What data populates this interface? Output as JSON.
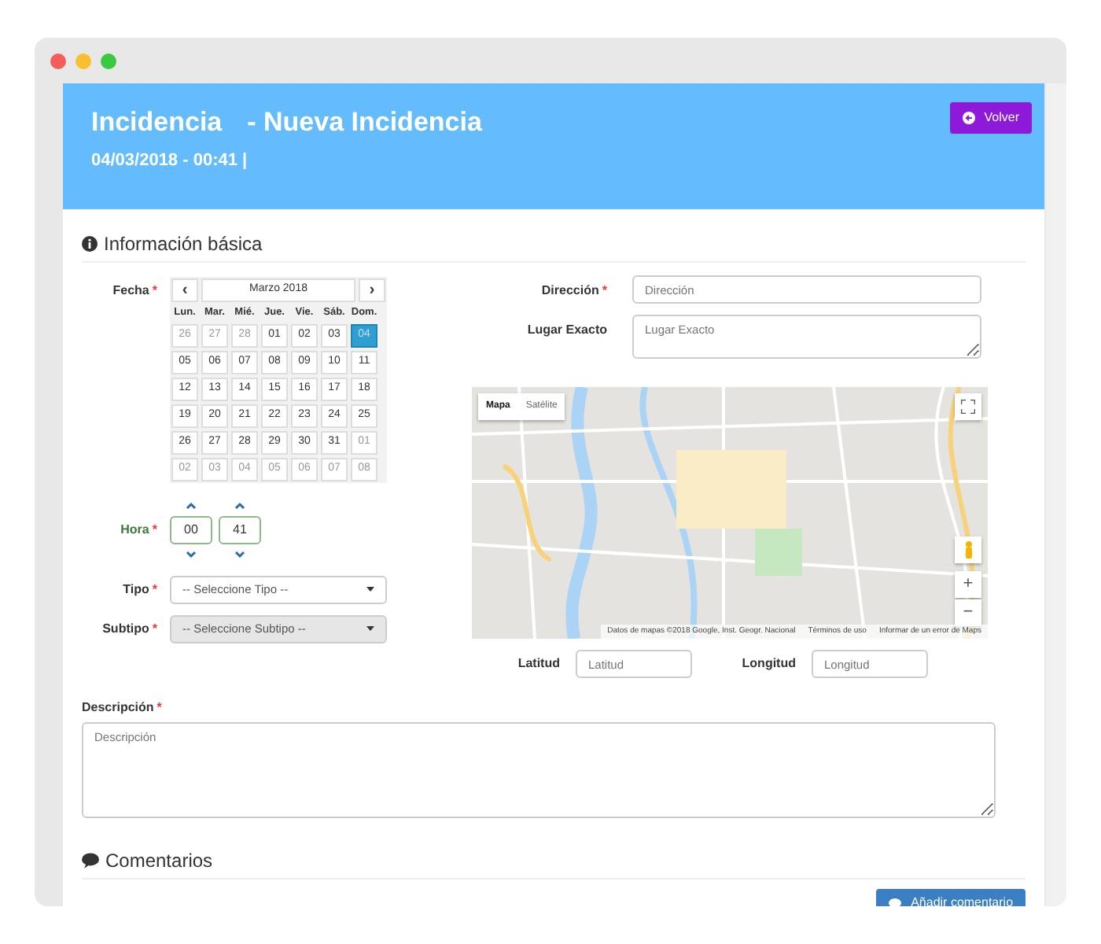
{
  "header": {
    "title": "Incidencia",
    "subtitle": "- Nueva Incidencia",
    "datetime": "04/03/2018 - 00:41 |",
    "back_button": "Volver"
  },
  "basic_section": {
    "title": "Información básica"
  },
  "fecha": {
    "label": "Fecha",
    "mark": "*",
    "calendar": {
      "prev": "‹",
      "next": "›",
      "month": "Marzo 2018",
      "weekdays": [
        "Lun.",
        "Mar.",
        "Mié.",
        "Jue.",
        "Vie.",
        "Sáb.",
        "Dom."
      ],
      "weeks": [
        [
          {
            "day": "26",
            "muted": true,
            "selected": false
          },
          {
            "day": "27",
            "muted": true,
            "selected": false
          },
          {
            "day": "28",
            "muted": true,
            "selected": false
          },
          {
            "day": "01",
            "muted": false,
            "selected": false
          },
          {
            "day": "02",
            "muted": false,
            "selected": false
          },
          {
            "day": "03",
            "muted": false,
            "selected": false
          },
          {
            "day": "04",
            "muted": false,
            "selected": true
          }
        ],
        [
          {
            "day": "05",
            "muted": false,
            "selected": false
          },
          {
            "day": "06",
            "muted": false,
            "selected": false
          },
          {
            "day": "07",
            "muted": false,
            "selected": false
          },
          {
            "day": "08",
            "muted": false,
            "selected": false
          },
          {
            "day": "09",
            "muted": false,
            "selected": false
          },
          {
            "day": "10",
            "muted": false,
            "selected": false
          },
          {
            "day": "11",
            "muted": false,
            "selected": false
          }
        ],
        [
          {
            "day": "12",
            "muted": false,
            "selected": false
          },
          {
            "day": "13",
            "muted": false,
            "selected": false
          },
          {
            "day": "14",
            "muted": false,
            "selected": false
          },
          {
            "day": "15",
            "muted": false,
            "selected": false
          },
          {
            "day": "16",
            "muted": false,
            "selected": false
          },
          {
            "day": "17",
            "muted": false,
            "selected": false
          },
          {
            "day": "18",
            "muted": false,
            "selected": false
          }
        ],
        [
          {
            "day": "19",
            "muted": false,
            "selected": false
          },
          {
            "day": "20",
            "muted": false,
            "selected": false
          },
          {
            "day": "21",
            "muted": false,
            "selected": false
          },
          {
            "day": "22",
            "muted": false,
            "selected": false
          },
          {
            "day": "23",
            "muted": false,
            "selected": false
          },
          {
            "day": "24",
            "muted": false,
            "selected": false
          },
          {
            "day": "25",
            "muted": false,
            "selected": false
          }
        ],
        [
          {
            "day": "26",
            "muted": false,
            "selected": false
          },
          {
            "day": "27",
            "muted": false,
            "selected": false
          },
          {
            "day": "28",
            "muted": false,
            "selected": false
          },
          {
            "day": "29",
            "muted": false,
            "selected": false
          },
          {
            "day": "30",
            "muted": false,
            "selected": false
          },
          {
            "day": "31",
            "muted": false,
            "selected": false
          },
          {
            "day": "01",
            "muted": true,
            "selected": false
          }
        ],
        [
          {
            "day": "02",
            "muted": true,
            "selected": false
          },
          {
            "day": "03",
            "muted": true,
            "selected": false
          },
          {
            "day": "04",
            "muted": true,
            "selected": false
          },
          {
            "day": "05",
            "muted": true,
            "selected": false
          },
          {
            "day": "06",
            "muted": true,
            "selected": false
          },
          {
            "day": "07",
            "muted": true,
            "selected": false
          },
          {
            "day": "08",
            "muted": true,
            "selected": false
          }
        ]
      ]
    }
  },
  "hora": {
    "label": "Hora",
    "mark": "*",
    "valid": true,
    "hours": "00",
    "minutes": "41"
  },
  "selects": [
    {
      "label": "Tipo",
      "mark": "*",
      "value": "-- Seleccione Tipo --",
      "disabled": false
    },
    {
      "label": "Subtipo",
      "mark": "*",
      "value": "-- Seleccione Subtipo --",
      "disabled": true
    }
  ],
  "direccion": {
    "label": "Dirección",
    "mark": "*",
    "placeholder": "Dirección"
  },
  "lugar": {
    "label": "Lugar Exacto",
    "placeholder": "Lugar Exacto"
  },
  "map": {
    "tabs": [
      {
        "label": "Mapa",
        "selected": true
      },
      {
        "label": "Satélite",
        "selected": false
      }
    ],
    "zoom_in": "+",
    "zoom_out": "−",
    "attribution": "Datos de mapas ©2018 Google, Inst. Geogr. Nacional",
    "terms": "Términos de uso",
    "report": "Informar de un error de Maps"
  },
  "coords": [
    {
      "label": "Latitud",
      "placeholder": "Latitud"
    },
    {
      "label": "Longitud",
      "placeholder": "Longitud"
    }
  ],
  "descripcion": {
    "label": "Descripción",
    "mark": "*",
    "placeholder": "Descripción"
  },
  "comments_section": {
    "title": "Comentarios",
    "add_button": "Añadir comentario"
  }
}
